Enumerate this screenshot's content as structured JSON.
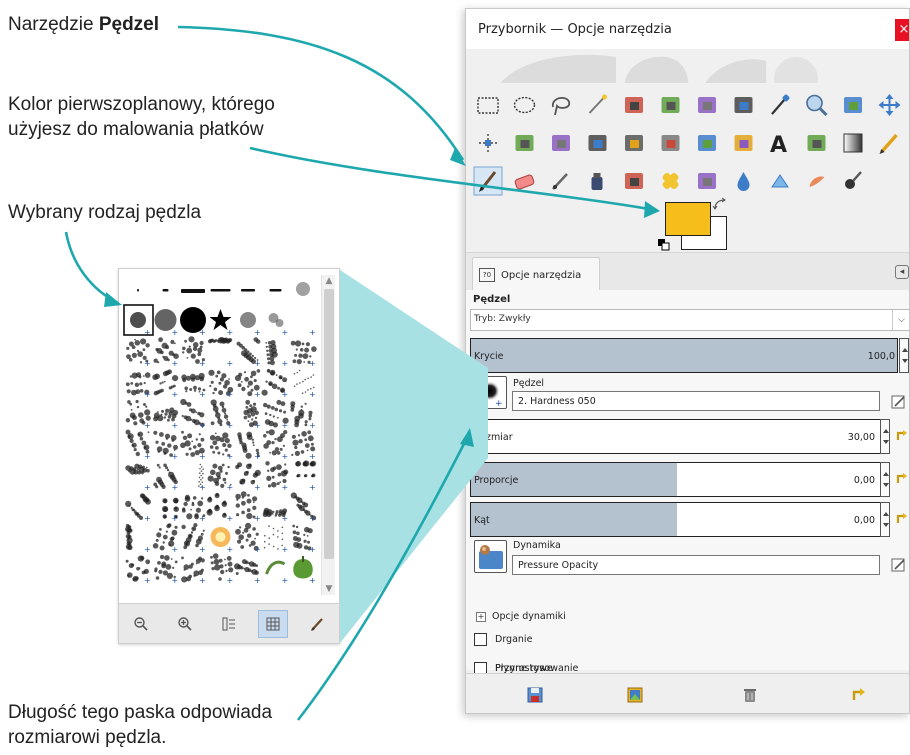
{
  "callouts": {
    "tool_prefix": "Narzędzie ",
    "tool_bold": "Pędzel",
    "fg_line1": "Kolor pierwszoplanowy, którego",
    "fg_line2": "użyjesz do malowania płatków",
    "brush_type": "Wybrany rodzaj pędzla",
    "size_line1": "Długość tego paska odpowiada",
    "size_line2": "rozmiarowi pędzla."
  },
  "colors": {
    "accent_teal": "#1ea8ae",
    "panel_teal": "#a7e1e3",
    "foreground": "#f5be1b",
    "background": "#ffffff",
    "slider_fill": "#b4c2d0",
    "close_red": "#e81123"
  },
  "toolbox": {
    "title": "Przybornik — Opcje narzędzia",
    "close_glyph": "×",
    "tab_label": "Opcje narzędzia",
    "tab_icon_text": "?0",
    "tool_icons": [
      "rect-select-icon",
      "ellipse-select-icon",
      "free-select-icon",
      "fuzzy-select-icon",
      "color-select-icon",
      "scissors-select-icon",
      "foreground-select-icon",
      "paths-icon",
      "color-picker-icon",
      "zoom-icon",
      "measure-icon",
      "move-icon",
      "align-icon",
      "transform-icon",
      "rotate-icon",
      "scale-icon",
      "shear-icon",
      "perspective-icon",
      "flip-icon",
      "cage-icon",
      "text-icon",
      "bucket-fill-icon",
      "gradient-icon",
      "pencil-icon",
      "paintbrush-icon",
      "eraser-icon",
      "airbrush-icon",
      "ink-icon",
      "mypaint-icon",
      "heal-icon",
      "clone-icon",
      "blur-icon",
      "dodge-icon",
      "smudge-icon",
      "mypaint-brush-icon"
    ]
  },
  "options": {
    "heading": "Pędzel",
    "mode_label": "Tryb: Zwykły",
    "opacity": {
      "label": "Krycie",
      "value": "100,0",
      "fraction": 1.0
    },
    "brush": {
      "caption": "Pędzel",
      "name": "2. Hardness 050"
    },
    "size": {
      "label": "Rozmiar",
      "value": "30,00",
      "fraction": 0.006
    },
    "aspect": {
      "label": "Proporcje",
      "value": "0,00",
      "fraction": 0.5
    },
    "angle": {
      "label": "Kąt",
      "value": "0,00",
      "fraction": 0.5
    },
    "dynamics": {
      "caption": "Dynamika",
      "name": "Pressure Opacity"
    },
    "dynamics_options": "Opcje dynamiki",
    "checkboxes": [
      "Drganie",
      "Płynne rysowanie",
      "Przyrostowe"
    ],
    "expander_glyph": "+"
  },
  "brush_panel": {
    "selected_index": 0,
    "toolbar": [
      "zoom-out-icon",
      "zoom-in-icon",
      "list-view-icon",
      "grid-view-icon",
      "edit-brush-icon"
    ]
  }
}
